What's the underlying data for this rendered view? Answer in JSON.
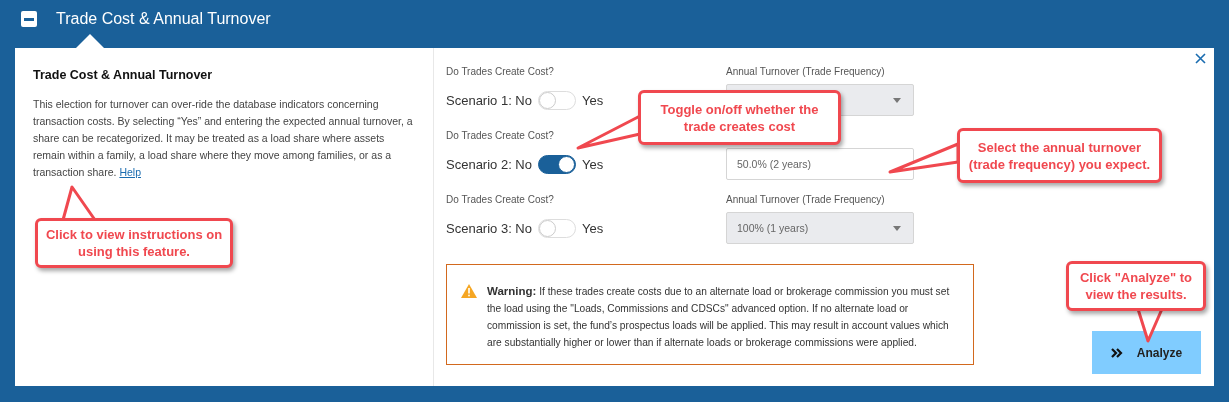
{
  "header": {
    "title": "Trade Cost & Annual Turnover",
    "expanded": true
  },
  "info": {
    "title": "Trade Cost & Annual Turnover",
    "text": "This election for turnover can over-ride the database indicators concerning transaction costs. By selecting “Yes” and entering the expected annual turnover, a share can be recategorized. It may be treated as a load share where assets remain within a family, a load share where they move among families, or as a transaction share.",
    "link": "Help"
  },
  "scenarios": [
    {
      "question": "Do Trades Create Cost?",
      "label": "Scenario 1: No",
      "yes": "Yes",
      "on": false,
      "turnover_label": "Annual Turnover (Trade Frequency)",
      "disabled": true
    },
    {
      "question": "Do Trades Create Cost?",
      "label": "Scenario 2: No",
      "yes": "Yes",
      "on": true,
      "value": "50.0% (2 years)",
      "disabled": false
    },
    {
      "question": "Do Trades Create Cost?",
      "label": "Scenario 3: No",
      "yes": "Yes",
      "on": false,
      "turnover_label": "Annual Turnover (Trade Frequency)",
      "value": "100% (1 years)",
      "disabled": true
    }
  ],
  "warning": {
    "title": "Warning:",
    "text": "If these trades create costs due to an alternate load or brokerage commission you must set the load using the \"Loads, Commissions and CDSCs\" advanced option. If no alternate load or commission is set, the fund’s prospectus loads will be applied. This may result in account values which are substantially higher or lower than if alternate loads or brokerage commissions were applied."
  },
  "button": {
    "label": "Analyze"
  },
  "callouts": [
    {
      "text": "Click to view instructions on using this feature."
    },
    {
      "text": "Toggle on/off whether the trade creates cost"
    },
    {
      "text": "Select the annual turnover (trade frequency) you expect."
    },
    {
      "text": "Click \"Analyze\" to view the results."
    }
  ]
}
